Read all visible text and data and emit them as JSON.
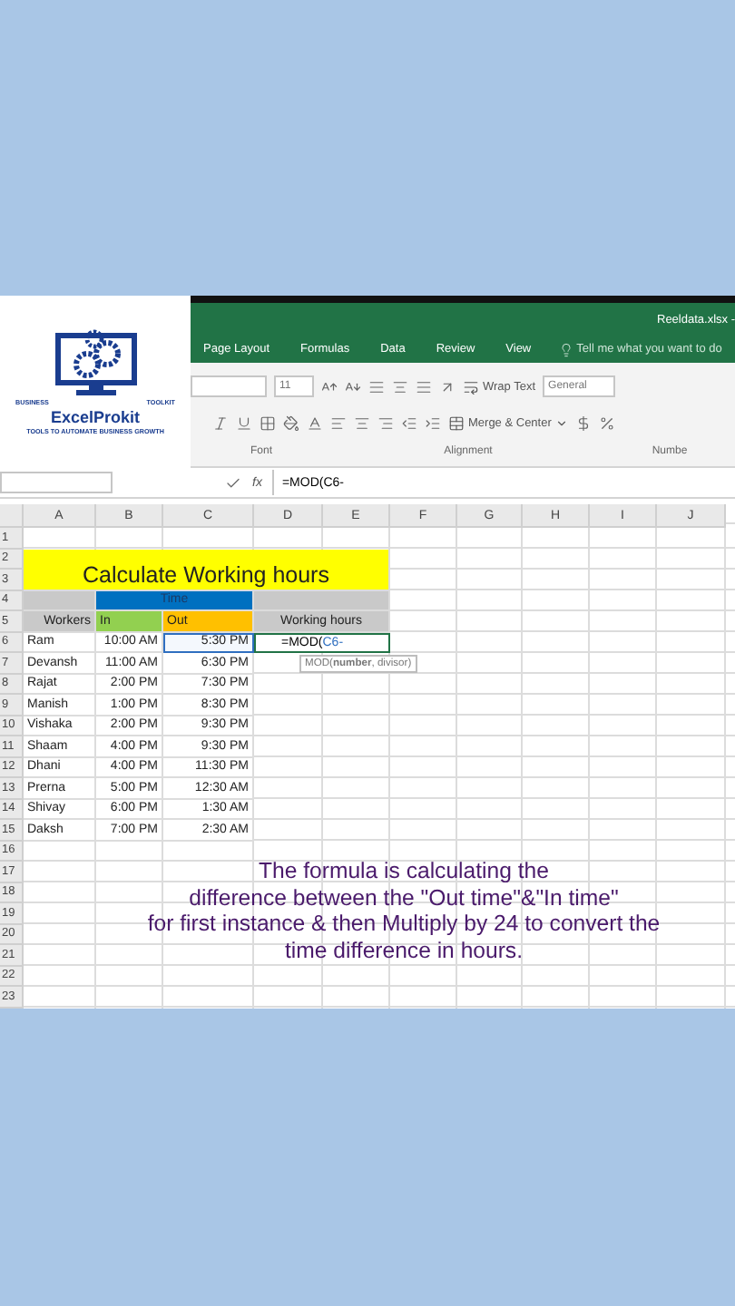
{
  "logo": {
    "top_left": "BUSINESS",
    "top_right": "TOOLKIT",
    "name": "ExcelProkit",
    "tagline": "TOOLS TO AUTOMATE BUSINESS GROWTH"
  },
  "window": {
    "title": "Reeldata.xlsx -"
  },
  "tabs": [
    {
      "label": "Page Layout",
      "selected": false
    },
    {
      "label": "Formulas",
      "selected": false
    },
    {
      "label": "Data",
      "selected": false
    },
    {
      "label": "Review",
      "selected": false
    },
    {
      "label": "View",
      "selected": false
    }
  ],
  "search": {
    "placeholder": "Tell me what you want to do"
  },
  "ribbon": {
    "font_size": "11",
    "wrap_text": "Wrap Text",
    "merge_center": "Merge & Center",
    "number_format": "General",
    "groups": [
      "Font",
      "Alignment",
      "Numbe"
    ]
  },
  "formula_bar": {
    "fx": "fx",
    "value": "=MOD(C6-"
  },
  "sheet": {
    "columns": [
      "A",
      "B",
      "C",
      "D",
      "E",
      "F",
      "G",
      "H",
      "I",
      "J"
    ],
    "row_numbers": [
      "1",
      "2",
      "3",
      "4",
      "5",
      "6",
      "7",
      "8",
      "9",
      "10",
      "11",
      "12",
      "13",
      "14",
      "15",
      "16",
      "17",
      "18",
      "19",
      "20",
      "21",
      "22",
      "23"
    ],
    "title": {
      "text": "Calculate Working hours",
      "color": "#ffff00"
    },
    "group_header": {
      "text": "Time",
      "color": "#0070c0"
    },
    "headers": [
      {
        "text": "Workers",
        "color": "#c9c9c9"
      },
      {
        "text": "In",
        "color": "#92d050"
      },
      {
        "text": "Out",
        "color": "#ffc000"
      },
      {
        "text": "Working hours",
        "color": "#c9c9c9"
      }
    ],
    "rows": [
      {
        "worker": "Ram",
        "in": "10:00 AM",
        "out": "5:30 PM",
        "reference": true
      },
      {
        "worker": "Devansh",
        "in": "11:00 AM",
        "out": "6:30 PM",
        "reference": false
      },
      {
        "worker": "Rajat",
        "in": "2:00 PM",
        "out": "7:30 PM",
        "reference": false
      },
      {
        "worker": "Manish",
        "in": "1:00 PM",
        "out": "8:30 PM",
        "reference": false
      },
      {
        "worker": "Vishaka",
        "in": "2:00 PM",
        "out": "9:30 PM",
        "reference": false
      },
      {
        "worker": "Shaam",
        "in": "4:00 PM",
        "out": "9:30 PM",
        "reference": false
      },
      {
        "worker": "Dhani",
        "in": "4:00 PM",
        "out": "11:30 PM",
        "reference": false
      },
      {
        "worker": "Prerna",
        "in": "5:00 PM",
        "out": "12:30 AM",
        "reference": false
      },
      {
        "worker": "Shivay",
        "in": "6:00 PM",
        "out": "1:30 AM",
        "reference": false
      },
      {
        "worker": "Daksh",
        "in": "7:00 PM",
        "out": "2:30 AM",
        "reference": false
      }
    ],
    "editing_cell": {
      "function": "=MOD(",
      "argument": "C6-"
    },
    "tooltip": "MOD(**number**, divisor)"
  },
  "caption": [
    "The formula is calculating the",
    "difference between the \"Out time\"&\"In time\"",
    "for first instance & then Multiply by 24 to convert the",
    "time difference in hours."
  ]
}
